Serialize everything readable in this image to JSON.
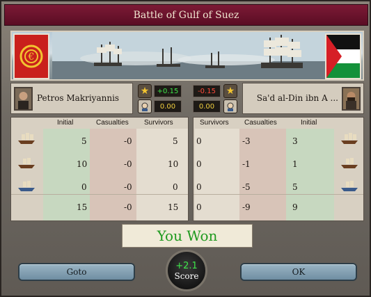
{
  "window": {
    "title": "Battle of Gulf of Suez"
  },
  "left": {
    "commander": "Petros Makriyannis",
    "prestige": "+0.15",
    "warscore": "0.00",
    "headers": {
      "initial": "Initial",
      "casualties": "Casualties",
      "survivors": "Survivors"
    },
    "rows": [
      {
        "initial": "5",
        "casualties": "-0",
        "survivors": "5"
      },
      {
        "initial": "10",
        "casualties": "-0",
        "survivors": "10"
      },
      {
        "initial": "0",
        "casualties": "-0",
        "survivors": "0"
      }
    ],
    "totals": {
      "initial": "15",
      "casualties": "-0",
      "survivors": "15"
    }
  },
  "right": {
    "commander": "Sa'd al-Din ibn A ...",
    "prestige": "-0.15",
    "warscore": "0.00",
    "headers": {
      "survivors": "Survivors",
      "casualties": "Casualties",
      "initial": "Initial"
    },
    "rows": [
      {
        "survivors": "0",
        "casualties": "-3",
        "initial": "3"
      },
      {
        "survivors": "0",
        "casualties": "-1",
        "initial": "1"
      },
      {
        "survivors": "0",
        "casualties": "-5",
        "initial": "5"
      }
    ],
    "totals": {
      "survivors": "0",
      "casualties": "-9",
      "initial": "9"
    }
  },
  "result": {
    "text": "You Won"
  },
  "score": {
    "value": "+2.1",
    "label": "Score"
  },
  "buttons": {
    "goto": "Goto",
    "ok": "OK"
  },
  "icons": [
    "star-icon",
    "face-icon",
    "ship-icon",
    "flag-icon",
    "portrait-icon"
  ],
  "colors": {
    "positive": "#3ee64a",
    "negative": "#ff4a3a",
    "title_bar": "#6a1029",
    "won": "#1f9a1f"
  }
}
